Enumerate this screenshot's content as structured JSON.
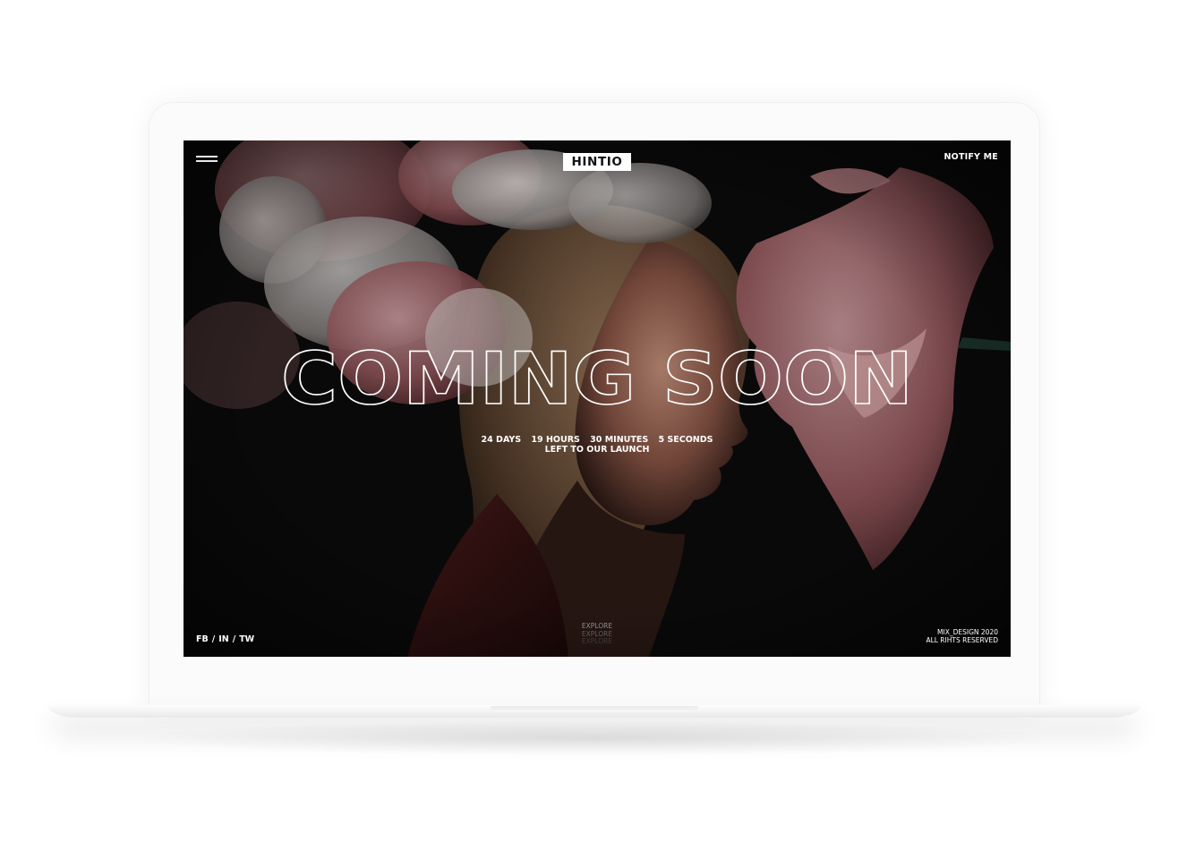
{
  "brand": {
    "logo": "HINTIO"
  },
  "header": {
    "notify_label": "NOTIFY ME"
  },
  "hero": {
    "headline": "COMING SOON"
  },
  "countdown": {
    "days": "24 DAYS",
    "hours": "19 HOURS",
    "minutes": "30 MINUTES",
    "seconds": "5 SECONDS",
    "caption": "LEFT TO OUR LAUNCH"
  },
  "social": {
    "fb": "FB",
    "in": "IN",
    "tw": "TW",
    "separator": "/"
  },
  "explore": [
    "EXPLORE",
    "EXPLORE",
    "EXPLORE"
  ],
  "footer": {
    "credit_line1": "MIX_DESIGN 2020",
    "credit_line2": "ALL RIHTS RESERVED"
  },
  "colors": {
    "background": "#0b0a0a",
    "text": "#ffffff",
    "flower_pink": "#b8797d",
    "device": "#fbfbfb"
  },
  "icons": {
    "menu": "hamburger-menu-icon"
  }
}
